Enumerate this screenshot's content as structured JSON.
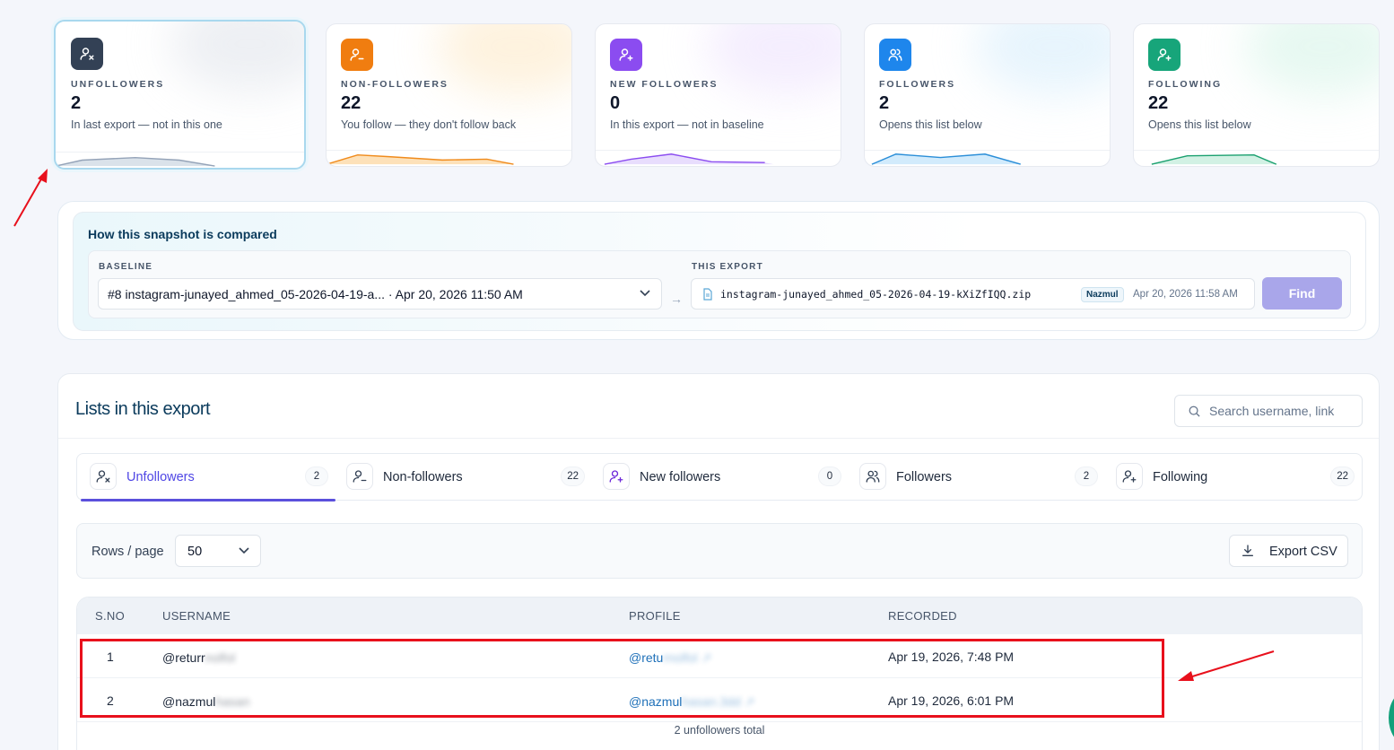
{
  "stats": [
    {
      "label": "UNFOLLOWERS",
      "value": "2",
      "desc": "In last export — not in this one",
      "icon": "user-x-icon",
      "color": "#334155"
    },
    {
      "label": "NON-FOLLOWERS",
      "value": "22",
      "desc": "You follow — they don't follow back",
      "icon": "user-minus-icon",
      "color": "#f07d10"
    },
    {
      "label": "NEW FOLLOWERS",
      "value": "0",
      "desc": "In this export — not in baseline",
      "icon": "user-plus-icon",
      "color": "#8b4cf0"
    },
    {
      "label": "FOLLOWERS",
      "value": "2",
      "desc": "Opens this list below",
      "icon": "users-icon",
      "color": "#1e86ec"
    },
    {
      "label": "FOLLOWING",
      "value": "22",
      "desc": "Opens this list below",
      "icon": "user-plus-icon",
      "color": "#17a57a"
    }
  ],
  "compare": {
    "title": "How this snapshot is compared",
    "baseline_label": "BASELINE",
    "baseline_value": "#8 instagram-junayed_ahmed_05-2026-04-19-a... · Apr 20, 2026 11:50 AM",
    "export_label": "THIS EXPORT",
    "export_file": "instagram-junayed_ahmed_05-2026-04-19-kXiZfIQQ.zip",
    "export_badge": "Nazmul",
    "export_date": "Apr 20, 2026 11:58 AM",
    "find_label": "Find"
  },
  "lists": {
    "title": "Lists in this export",
    "search_placeholder": "Search username, link",
    "tabs": [
      {
        "label": "Unfollowers",
        "count": "2"
      },
      {
        "label": "Non-followers",
        "count": "22"
      },
      {
        "label": "New followers",
        "count": "0"
      },
      {
        "label": "Followers",
        "count": "2"
      },
      {
        "label": "Following",
        "count": "22"
      }
    ],
    "rows_label": "Rows / page",
    "rows_value": "50",
    "export_csv": "Export CSV",
    "columns": [
      "S.NO",
      "USERNAME",
      "PROFILE",
      "RECORDED"
    ],
    "rows": [
      {
        "sno": "1",
        "user": "@returr",
        "user_hidden": "nolfol",
        "profile": "@retu",
        "profile_hidden": "rnolfol",
        "recorded": "Apr 19, 2026, 7:48 PM"
      },
      {
        "sno": "2",
        "user": "@nazmul",
        "user_hidden": "hasan",
        "profile": "@nazmul",
        "profile_hidden": "hasan.3dd",
        "recorded": "Apr 19, 2026, 6:01 PM"
      }
    ],
    "footer": "2 unfollowers total"
  }
}
